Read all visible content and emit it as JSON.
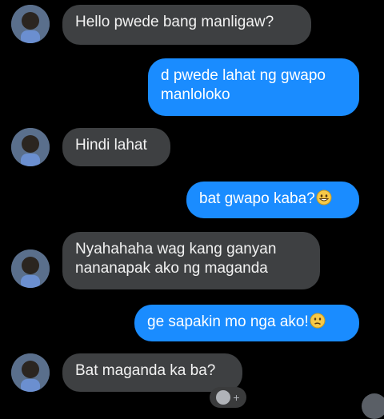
{
  "messages": [
    {
      "side": "in",
      "lines": [
        "Hello pwede bang manligaw?"
      ]
    },
    {
      "side": "out",
      "lines": [
        "d pwede lahat ng gwapo",
        "manloloko"
      ]
    },
    {
      "side": "in",
      "lines": [
        "Hindi lahat"
      ]
    },
    {
      "side": "out",
      "lines": [
        "bat gwapo kaba?"
      ],
      "emoji": "grinning-face"
    },
    {
      "side": "in",
      "lines": [
        "Nyahahaha wag kang ganyan",
        "nananapak ako ng maganda"
      ]
    },
    {
      "side": "out",
      "lines": [
        "ge sapakin mo nga ako!"
      ],
      "emoji": "confused-face"
    },
    {
      "side": "in",
      "lines": [
        "Bat maganda ka ba?"
      ]
    }
  ],
  "react_button": {
    "symbol": "+"
  },
  "colors": {
    "background": "#000000",
    "incoming_bubble": "#3e4042",
    "outgoing_bubble": "#1a8cff",
    "text": "#ffffff"
  }
}
